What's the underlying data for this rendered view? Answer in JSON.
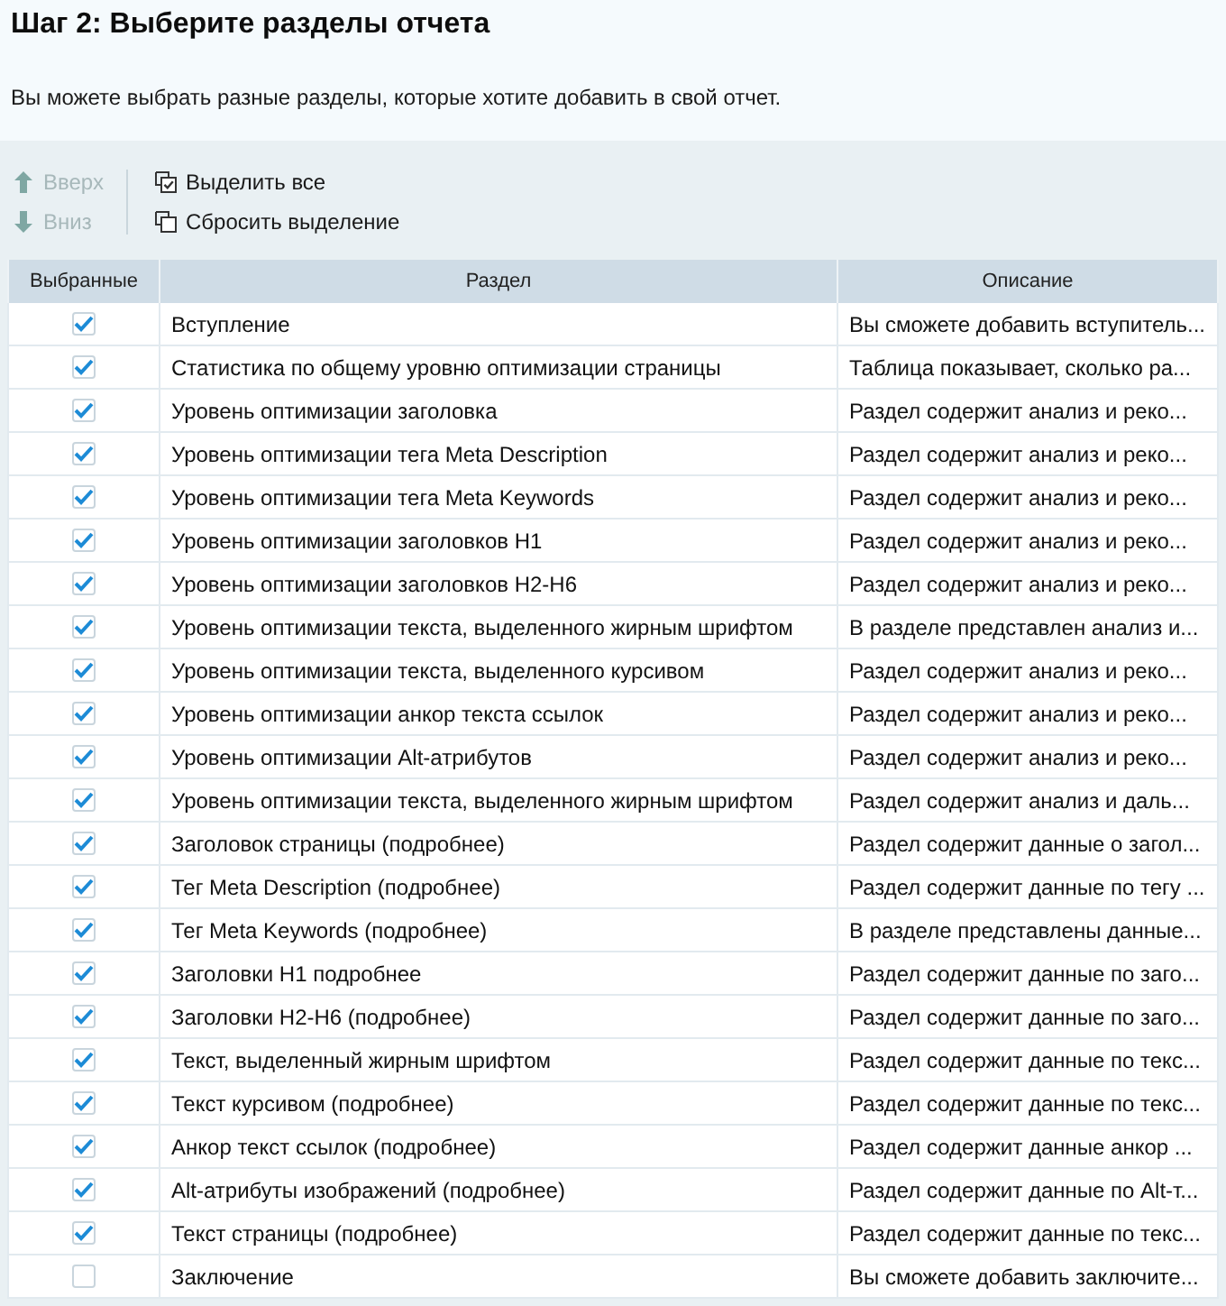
{
  "title": "Шаг 2: Выберите разделы отчета",
  "subtitle": "Вы можете выбрать разные разделы, которые хотите добавить в свой отчет.",
  "toolbar": {
    "move_buttons": [
      {
        "kind": "up",
        "label": "Вверх",
        "disabled": true
      },
      {
        "kind": "down",
        "label": "Вниз",
        "disabled": true
      }
    ],
    "selection_buttons": [
      {
        "kind": "select_all",
        "label": "Выделить все"
      },
      {
        "kind": "clear_selection",
        "label": "Сбросить выделение"
      }
    ]
  },
  "table": {
    "columns": [
      "Выбранные",
      "Раздел",
      "Описание"
    ],
    "rows": [
      {
        "checked": true,
        "section": "Вступление",
        "description": "Вы сможете добавить вступитель..."
      },
      {
        "checked": true,
        "section": "Статистика по общему уровню оптимизации страницы",
        "description": "Таблица показывает, сколько ра..."
      },
      {
        "checked": true,
        "section": "Уровень оптимизации заголовка",
        "description": "Раздел содержит анализ и реко..."
      },
      {
        "checked": true,
        "section": "Уровень оптимизации тега Meta Description",
        "description": "Раздел содержит анализ и реко..."
      },
      {
        "checked": true,
        "section": "Уровень оптимизации тега Meta Keywords",
        "description": "Раздел содержит анализ и реко..."
      },
      {
        "checked": true,
        "section": "Уровень оптимизации заголовков H1",
        "description": "Раздел содержит анализ и реко..."
      },
      {
        "checked": true,
        "section": "Уровень оптимизации заголовков H2-H6",
        "description": "Раздел содержит анализ и реко..."
      },
      {
        "checked": true,
        "section": "Уровень оптимизации текста, выделенного жирным шрифтом",
        "description": "В разделе представлен анализ и..."
      },
      {
        "checked": true,
        "section": "Уровень оптимизации текста, выделенного курсивом",
        "description": "Раздел содержит анализ и реко..."
      },
      {
        "checked": true,
        "section": "Уровень оптимизации анкор текста ссылок",
        "description": "Раздел содержит анализ и реко..."
      },
      {
        "checked": true,
        "section": "Уровень оптимизации Alt-атрибутов",
        "description": "Раздел содержит анализ и реко..."
      },
      {
        "checked": true,
        "section": "Уровень оптимизации текста, выделенного жирным шрифтом",
        "description": "Раздел содержит анализ и даль..."
      },
      {
        "checked": true,
        "section": "Заголовок страницы (подробнее)",
        "description": "Раздел содержит данные о загол..."
      },
      {
        "checked": true,
        "section": "Тег Meta Description (подробнее)",
        "description": "Раздел содержит данные по тегу ..."
      },
      {
        "checked": true,
        "section": "Тег Meta Keywords (подробнее)",
        "description": "В разделе представлены данные..."
      },
      {
        "checked": true,
        "section": "Заголовки H1 подробнее",
        "description": "Раздел содержит данные по заго..."
      },
      {
        "checked": true,
        "section": "Заголовки H2-H6 (подробнее)",
        "description": "Раздел содержит данные по заго..."
      },
      {
        "checked": true,
        "section": "Текст, выделенный жирным шрифтом",
        "description": "Раздел содержит данные по текс..."
      },
      {
        "checked": true,
        "section": "Текст курсивом (подробнее)",
        "description": "Раздел содержит данные по текс..."
      },
      {
        "checked": true,
        "section": "Анкор текст ссылок (подробнее)",
        "description": "Раздел содержит данные анкор ..."
      },
      {
        "checked": true,
        "section": "Alt-атрибуты изображений (подробнее)",
        "description": "Раздел содержит данные по Alt-т..."
      },
      {
        "checked": true,
        "section": "Текст страницы (подробнее)",
        "description": "Раздел содержит данные по текс..."
      },
      {
        "checked": false,
        "section": "Заключение",
        "description": "Вы сможете добавить заключите..."
      }
    ]
  }
}
